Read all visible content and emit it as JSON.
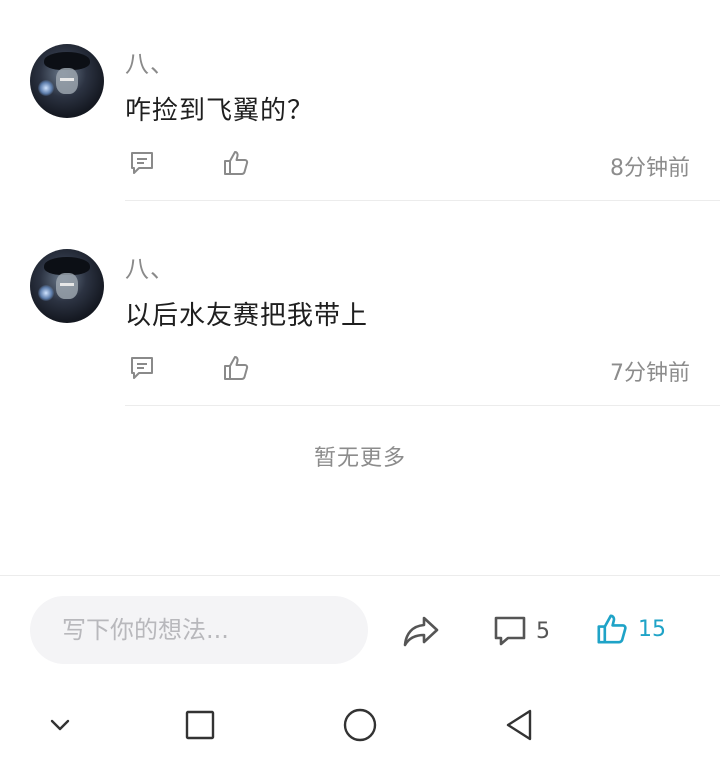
{
  "comments": [
    {
      "username": "八、",
      "content": "咋捡到飞翼的？",
      "time": "8分钟前"
    },
    {
      "username": "八、",
      "content": "以后水友赛把我带上",
      "time": "7分钟前"
    }
  ],
  "list_end_text": "暂无更多",
  "bottom_bar": {
    "input_placeholder": "写下你的想法...",
    "comment_count": "5",
    "like_count": "15"
  },
  "colors": {
    "accent": "#1fa3c7",
    "muted_text": "#8c8c8c",
    "input_bg": "#f4f4f6"
  },
  "icons": {
    "reply": "comment-reply-icon",
    "like": "thumbs-up-icon",
    "share": "share-arrow-icon",
    "comments": "speech-bubble-icon",
    "nav_down": "chevron-down-icon",
    "nav_recents": "square-icon",
    "nav_home": "circle-icon",
    "nav_back": "triangle-back-icon"
  }
}
